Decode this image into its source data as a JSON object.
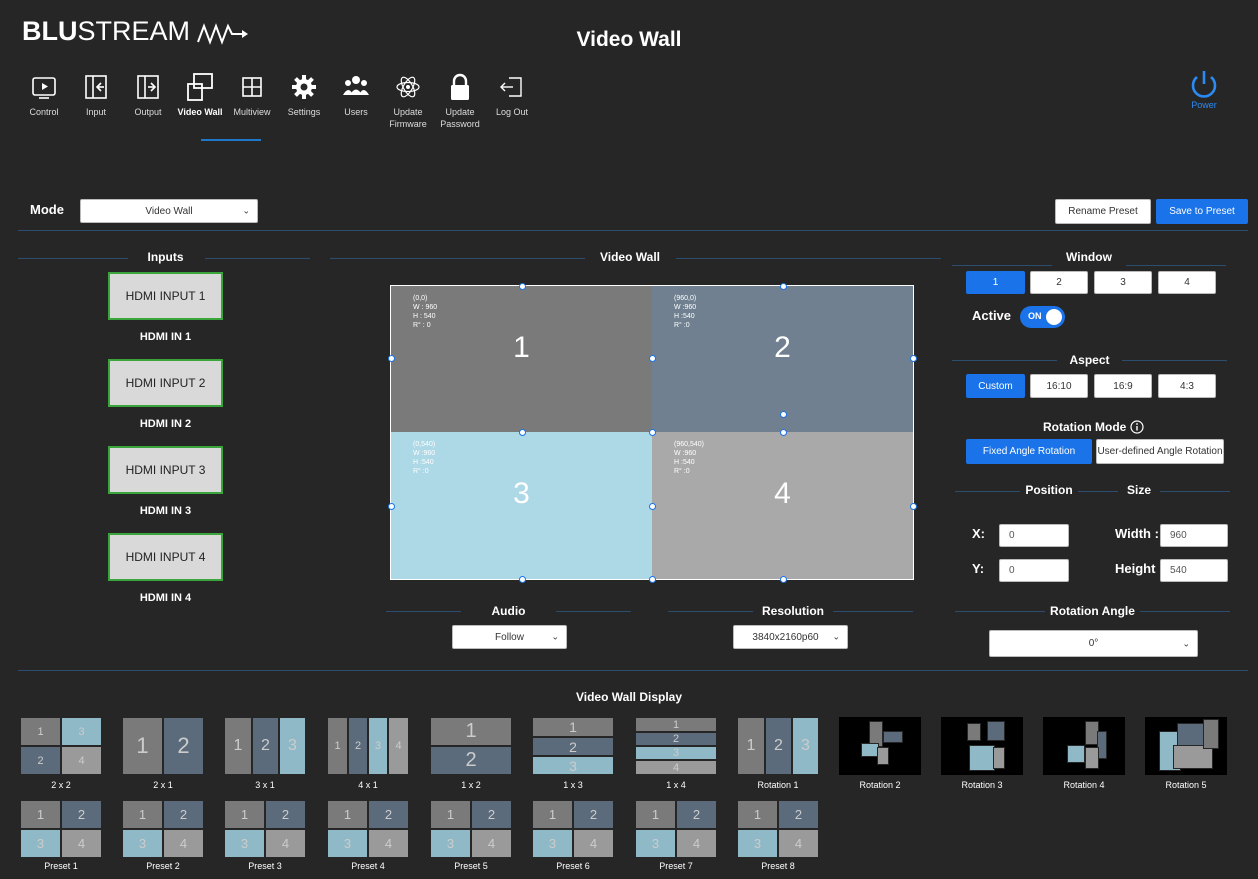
{
  "header": {
    "logo_bold": "BLU",
    "logo_rest": "STREAM",
    "title": "Video Wall",
    "nav": [
      {
        "label": "Control"
      },
      {
        "label": "Input"
      },
      {
        "label": "Output"
      },
      {
        "label": "Video Wall"
      },
      {
        "label": "Multiview"
      },
      {
        "label": "Settings"
      },
      {
        "label": "Users"
      },
      {
        "label": "Update Firmware"
      },
      {
        "label": "Update Password"
      },
      {
        "label": "Log Out"
      }
    ],
    "power_label": "Power"
  },
  "mode": {
    "label": "Mode",
    "selected": "Video Wall",
    "rename_label": "Rename Preset",
    "save_label": "Save to Preset"
  },
  "inputs": {
    "title": "Inputs",
    "items": [
      {
        "button": "HDMI INPUT 1",
        "name": "HDMI IN 1"
      },
      {
        "button": "HDMI INPUT 2",
        "name": "HDMI IN 2"
      },
      {
        "button": "HDMI INPUT 3",
        "name": "HDMI IN 3"
      },
      {
        "button": "HDMI INPUT 4",
        "name": "HDMI IN 4"
      }
    ]
  },
  "wall": {
    "title": "Video Wall",
    "cells": [
      {
        "pos": "(0,0)",
        "w": "W : 960",
        "h": "H : 540",
        "r": "R° : 0",
        "num": "1",
        "color": "#7a7a7a"
      },
      {
        "pos": "(960,0)",
        "w": "W :960",
        "h": "H :540",
        "r": "R° :0",
        "num": "2",
        "color": "#708090"
      },
      {
        "pos": "(0,540)",
        "w": "W :960",
        "h": "H :540",
        "r": "R° :0",
        "num": "3",
        "color": "#add8e6"
      },
      {
        "pos": "(960,540)",
        "w": "W :960",
        "h": "H :540",
        "r": "R° :0",
        "num": "4",
        "color": "#a9a9a9"
      }
    ]
  },
  "audio": {
    "title": "Audio",
    "selected": "Follow"
  },
  "resolution": {
    "title": "Resolution",
    "selected": "3840x2160p60"
  },
  "window": {
    "title": "Window",
    "buttons": [
      "1",
      "2",
      "3",
      "4"
    ],
    "active_label": "Active",
    "toggle_text": "ON"
  },
  "aspect": {
    "title": "Aspect",
    "buttons": [
      "Custom",
      "16:10",
      "16:9",
      "4:3"
    ]
  },
  "rotation_mode": {
    "title": "Rotation Mode",
    "fixed": "Fixed Angle Rotation",
    "user": "User-defined Angle Rotation"
  },
  "position": {
    "title": "Position",
    "x_label": "X:",
    "x": "0",
    "y_label": "Y:",
    "y": "0"
  },
  "size": {
    "title": "Size",
    "width_label": "Width :",
    "width": "960",
    "height_label": "Height :",
    "height": "540"
  },
  "rotation_angle": {
    "title": "Rotation Angle",
    "selected": "0°"
  },
  "display": {
    "title": "Video Wall Display",
    "row1": [
      "2 x 2",
      "2 x 1",
      "3 x 1",
      "4 x 1",
      "1 x 2",
      "1 x 3",
      "1 x 4",
      "Rotation 1",
      "Rotation 2",
      "Rotation 3",
      "Rotation 4",
      "Rotation 5"
    ],
    "row2": [
      "Preset 1",
      "Preset 2",
      "Preset 3",
      "Preset 4",
      "Preset 5",
      "Preset 6",
      "Preset 7",
      "Preset 8"
    ]
  },
  "colors": {
    "accent": "#1a73e8",
    "cell1": "#7a7a7a",
    "cell2": "#5b6b7c",
    "cell3": "#8fb9c7",
    "cell4": "#9a9a9a"
  }
}
